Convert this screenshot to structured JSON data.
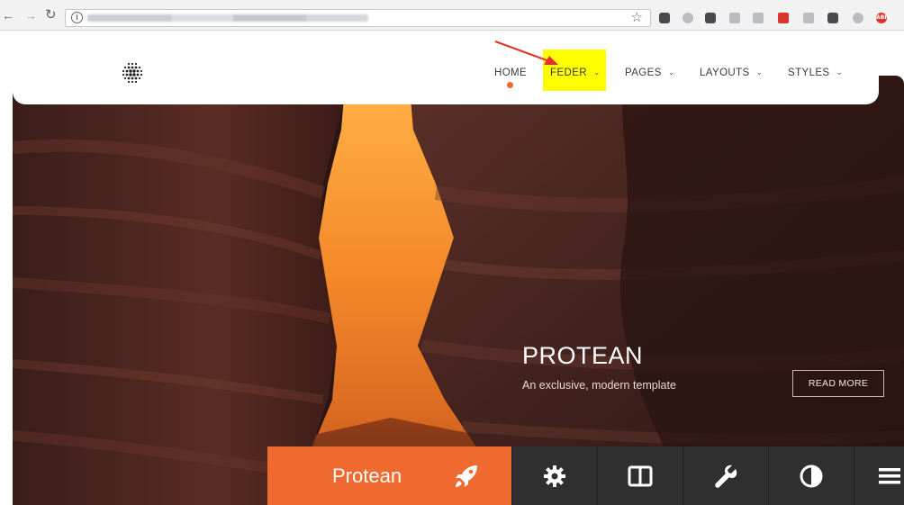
{
  "browser": {
    "back_icon": "back-arrow-icon",
    "forward_icon": "forward-arrow-icon",
    "reload_icon": "reload-icon",
    "site_info_icon": "info-icon",
    "bookmark_icon": "star-icon",
    "extensions": [
      "pocket-icon",
      "extension-icon",
      "extension-icon",
      "extension-icon",
      "extension-icon",
      "extension-icon",
      "extension-icon",
      "extension-icon",
      "extension-icon",
      "adblock-plus-icon"
    ],
    "adblock_label": "ABP"
  },
  "header": {
    "logo_icon": "dot-grid-logo-icon",
    "nav": [
      {
        "label": "HOME",
        "active": true
      },
      {
        "label": "FEDER",
        "dropdown": true,
        "highlighted": true
      },
      {
        "label": "PAGES",
        "dropdown": true
      },
      {
        "label": "LAYOUTS",
        "dropdown": true
      },
      {
        "label": "STYLES",
        "dropdown": true
      }
    ],
    "dropdown_glyph": "⌄",
    "highlight_color": "#ffff00",
    "annotation_arrow_color": "#e0322b"
  },
  "hero": {
    "title": "PROTEAN",
    "subtitle": "An exclusive, modern template",
    "button_label": "READ MORE"
  },
  "toolbar": {
    "brand": "Protean",
    "brand_icon": "rocket-icon",
    "buttons": [
      "gear-icon",
      "columns-icon",
      "wrench-icon",
      "contrast-icon",
      "menu-icon"
    ]
  },
  "colors": {
    "accent": "#f06a2f",
    "toolbar_bg": "#2f2f2f",
    "text_dark": "#3b3b3b"
  }
}
